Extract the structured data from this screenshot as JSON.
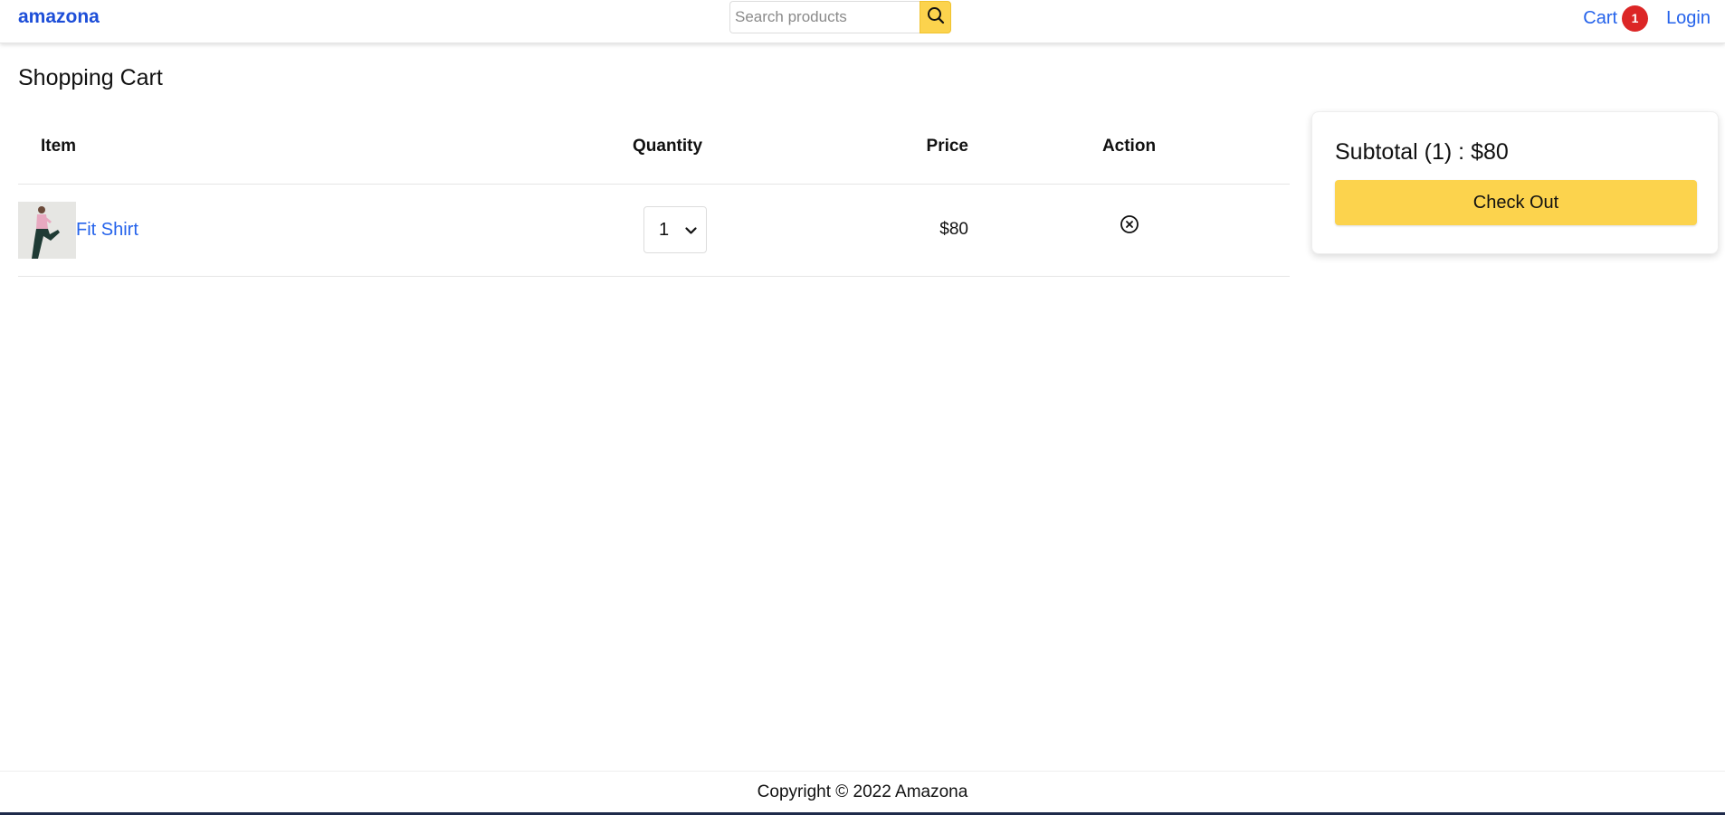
{
  "navbar": {
    "brand": "amazona",
    "search_placeholder": "Search products",
    "search_icon": "search-icon",
    "cart_label": "Cart",
    "cart_count": "1",
    "login_label": "Login"
  },
  "page": {
    "title": "Shopping Cart"
  },
  "cart": {
    "headers": {
      "item": "Item",
      "quantity": "Quantity",
      "price": "Price",
      "action": "Action"
    },
    "rows": [
      {
        "name": "Fit Shirt",
        "quantity": "1",
        "price": "$80",
        "remove_icon": "close-circle-icon"
      }
    ]
  },
  "summary": {
    "subtotal": "Subtotal (1) : $80",
    "checkout_label": "Check Out"
  },
  "footer": {
    "copyright": "Copyright © 2022 Amazona"
  },
  "colors": {
    "accent": "#fcd34d",
    "link": "#2563eb",
    "badge": "#dc2626"
  }
}
